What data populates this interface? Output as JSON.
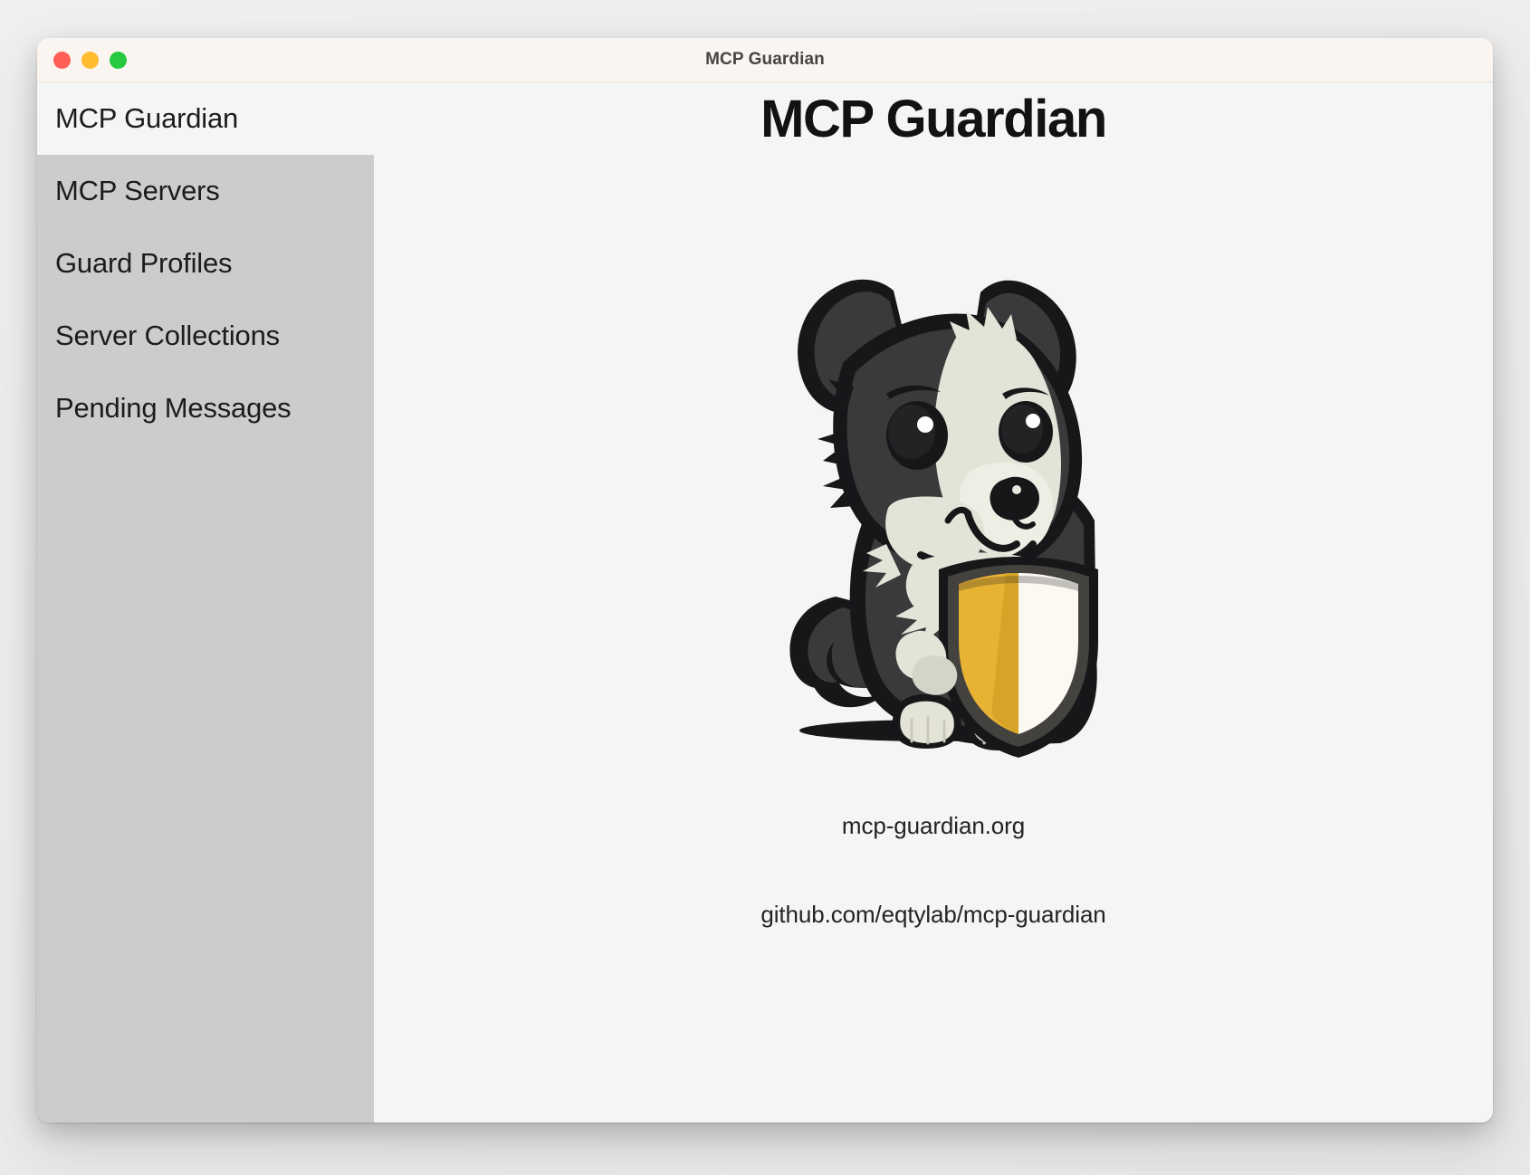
{
  "window": {
    "title": "MCP Guardian",
    "controls": [
      {
        "name": "close",
        "color": "#ff5f57"
      },
      {
        "name": "minimize",
        "color": "#febc2e"
      },
      {
        "name": "maximize",
        "color": "#26c940"
      }
    ]
  },
  "sidebar": {
    "header": {
      "label": "MCP Guardian",
      "active": true
    },
    "items": [
      {
        "label": "MCP Servers"
      },
      {
        "label": "Guard Profiles"
      },
      {
        "label": "Server Collections"
      },
      {
        "label": "Pending Messages"
      }
    ],
    "background_color": "#cccccc"
  },
  "main": {
    "title": "MCP Guardian",
    "logo": {
      "name": "border-collie-shield-logo",
      "colors": {
        "outline": "#17171a",
        "fur_dark": "#3a3a3c",
        "fur_light": "#e4e3d7",
        "shield_gold": "#e8b233",
        "shield_cream": "#fbf9f1",
        "shield_rim": "#44423f"
      }
    },
    "site_link": "mcp-guardian.org",
    "repo_link": "github.com/eqtylab/mcp-guardian"
  },
  "theme": {
    "page_background": "#eeeeee",
    "window_background": "#f5f5f5",
    "titlebar_background": "#faf5f0",
    "titlebar_text": "#4a4440",
    "text_primary": "#1c1c1c"
  }
}
